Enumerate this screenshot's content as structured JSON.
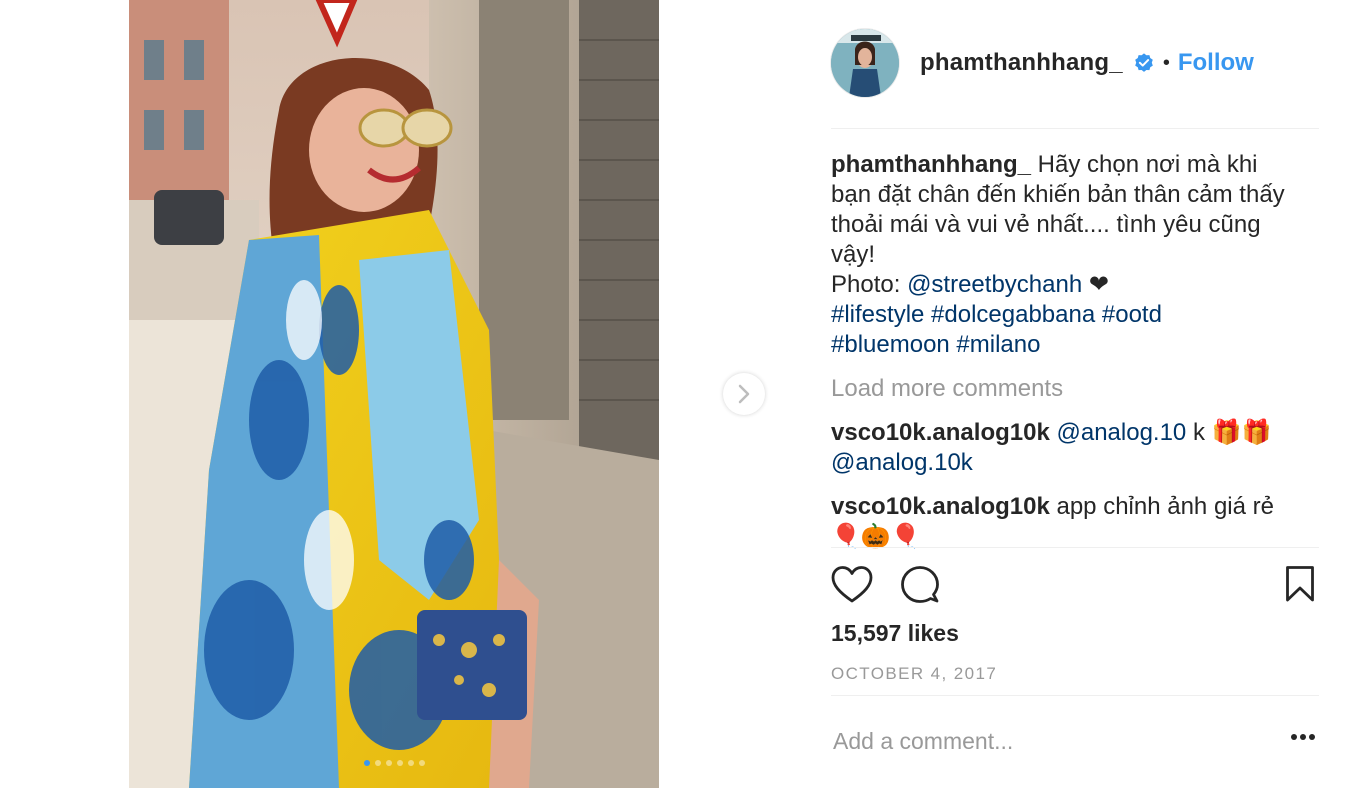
{
  "post": {
    "username": "phamthanhhang_",
    "separator": "•",
    "follow_label": "Follow",
    "caption": {
      "username": "phamthanhhang_",
      "text_lines": [
        " Hãy chọn nơi mà khi",
        "bạn đặt chân đến khiến bản thân cảm thấy",
        "thoải mái và vui vẻ nhất.... tình yêu cũng",
        "vậy!"
      ],
      "photo_prefix": "Photo: ",
      "photo_mention": "@streetbychanh",
      "photo_suffix": " ❤",
      "hashtags_line1": "#lifestyle #dolcegabbana #ootd",
      "hashtags_line2": "#bluemoon #milano"
    },
    "load_more_label": "Load more comments",
    "comments": [
      {
        "username": "vsco10k.analog10k",
        "mention": "@analog.10",
        "text": " k 🎁🎁",
        "mention2": "@analog.10k"
      },
      {
        "username": "vsco10k.analog10k",
        "text_line1": " app chỉnh ảnh giá rẻ",
        "text_line2": "🎈🎃🎈"
      }
    ],
    "likes": "15,597 likes",
    "date": "OCTOBER 4, 2017",
    "comment_placeholder": "Add a comment...",
    "carousel": {
      "slides": 6,
      "active_index": 0
    }
  },
  "icons": {
    "verified": "verified-badge-icon",
    "like": "heart-icon",
    "comment": "speech-bubble-icon",
    "save": "bookmark-icon",
    "next": "chevron-right-icon",
    "more": "ellipsis-icon"
  },
  "colors": {
    "accent": "#3897f0",
    "link": "#003569",
    "muted": "#999999",
    "text": "#262626"
  }
}
